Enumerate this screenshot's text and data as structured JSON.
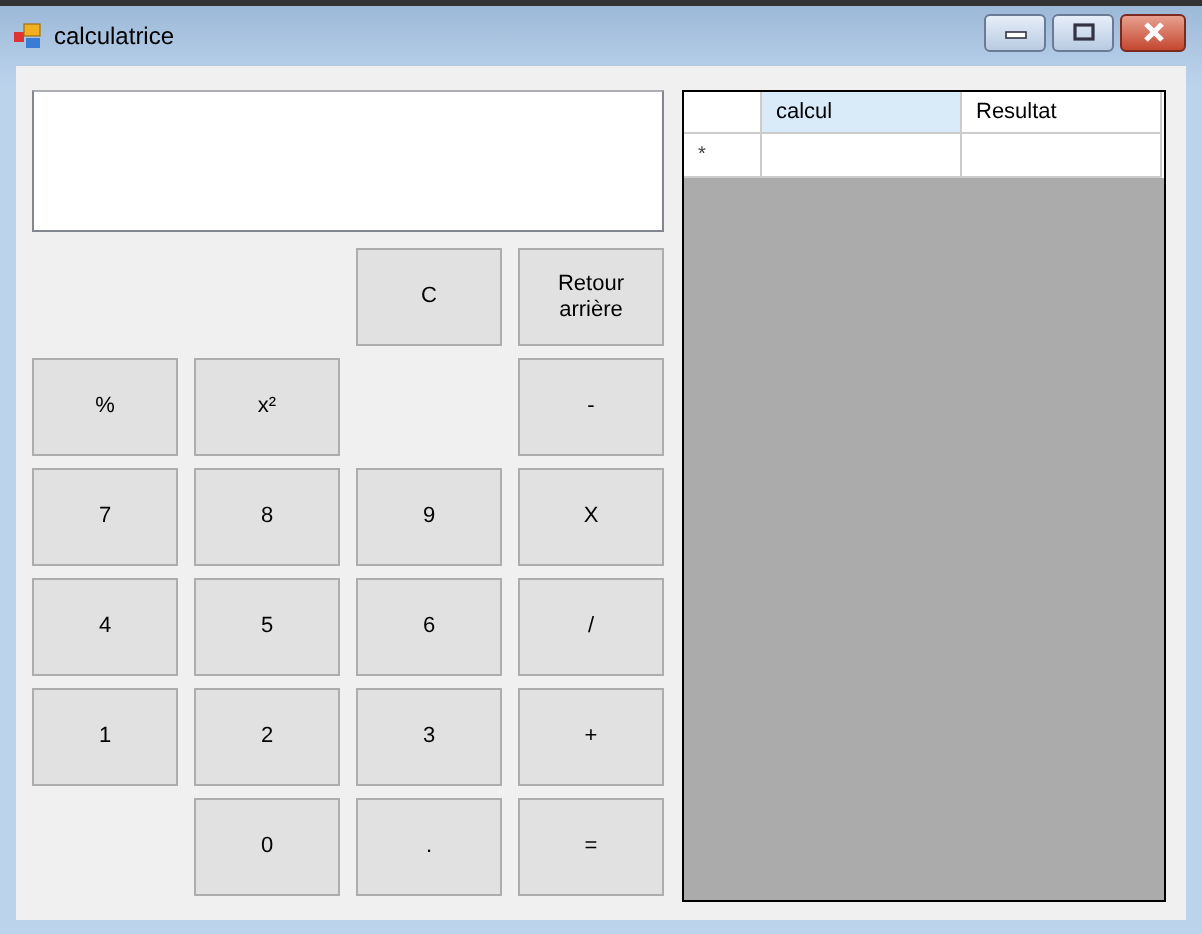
{
  "window": {
    "title": "calculatrice"
  },
  "keys": [
    {
      "kind": "blank"
    },
    {
      "kind": "blank"
    },
    {
      "kind": "key",
      "label": "C"
    },
    {
      "kind": "key",
      "label": "Retour arrière"
    },
    {
      "kind": "key",
      "label": "%"
    },
    {
      "kind": "key",
      "label": "x²"
    },
    {
      "kind": "blank"
    },
    {
      "kind": "key",
      "label": "-"
    },
    {
      "kind": "key",
      "label": "7"
    },
    {
      "kind": "key",
      "label": "8"
    },
    {
      "kind": "key",
      "label": "9"
    },
    {
      "kind": "key",
      "label": "X"
    },
    {
      "kind": "key",
      "label": "4"
    },
    {
      "kind": "key",
      "label": "5"
    },
    {
      "kind": "key",
      "label": "6"
    },
    {
      "kind": "key",
      "label": "/"
    },
    {
      "kind": "key",
      "label": "1"
    },
    {
      "kind": "key",
      "label": "2"
    },
    {
      "kind": "key",
      "label": "3"
    },
    {
      "kind": "key",
      "label": "+"
    },
    {
      "kind": "blank"
    },
    {
      "kind": "key",
      "label": "0"
    },
    {
      "kind": "key",
      "label": "."
    },
    {
      "kind": "key",
      "label": "="
    }
  ],
  "table": {
    "columns": [
      {
        "label": "calcul",
        "selected": true
      },
      {
        "label": "Resultat",
        "selected": false
      }
    ],
    "new_row_marker": "*"
  }
}
